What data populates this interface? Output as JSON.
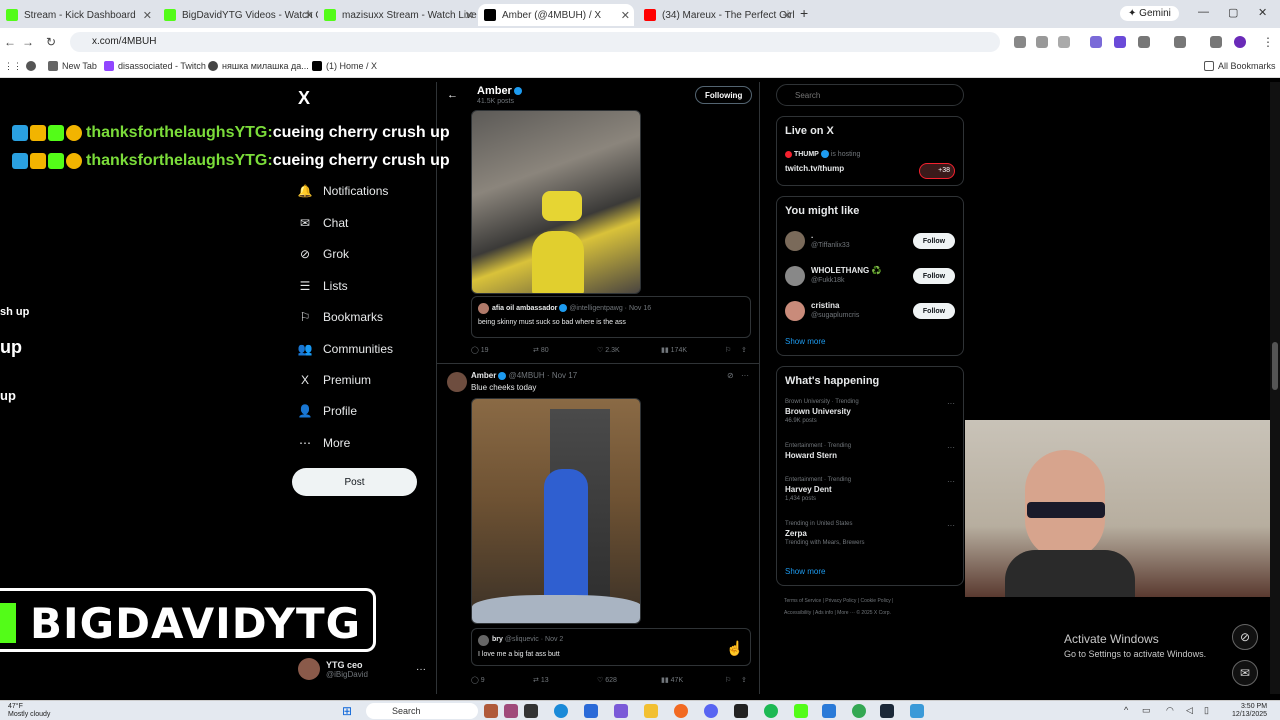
{
  "browser": {
    "tabs": [
      {
        "label": "Stream - Kick Dashboard",
        "color": "#53fc18"
      },
      {
        "label": "BigDavidYTG Videos - Watch O",
        "color": "#53fc18"
      },
      {
        "label": "mazisuxx Stream - Watch Live o",
        "color": "#53fc18"
      },
      {
        "label": "Amber (@4MBUH) / X",
        "color": "#000000"
      },
      {
        "label": "(34) Mareux - The Perfect Girl",
        "color": "#ff0000"
      }
    ],
    "gemini_label": "Gemini",
    "url": "x.com/4MBUH",
    "bookmarks": [
      "New Tab",
      "disassociated - Twitch",
      "няшка милашка да...",
      "(1) Home / X"
    ],
    "all_bookmarks": "All Bookmarks"
  },
  "x": {
    "logo": "X",
    "nav": [
      {
        "label": "Notifications",
        "icon": "bell-icon",
        "glyph": "🔔"
      },
      {
        "label": "Chat",
        "icon": "chat-icon",
        "glyph": "✉"
      },
      {
        "label": "Grok",
        "icon": "grok-icon",
        "glyph": "⊘"
      },
      {
        "label": "Lists",
        "icon": "lists-icon",
        "glyph": "☰"
      },
      {
        "label": "Bookmarks",
        "icon": "bookmark-icon",
        "glyph": "⚐"
      },
      {
        "label": "Communities",
        "icon": "communities-icon",
        "glyph": "👥"
      },
      {
        "label": "Premium",
        "icon": "premium-icon",
        "glyph": "X"
      },
      {
        "label": "Profile",
        "icon": "profile-icon",
        "glyph": "👤"
      },
      {
        "label": "More",
        "icon": "more-icon",
        "glyph": "⋯"
      }
    ],
    "post_button": "Post",
    "account": {
      "name": "YTG ceo",
      "handle": "@iBigDavid"
    },
    "header": {
      "name": "Amber",
      "count": "41.5K posts",
      "follow_state": "Following"
    },
    "quote1": {
      "name": "afia oil ambassador",
      "handle": "@intelligentpawg · Nov 16",
      "text": "being skinny must suck so bad where is the ass"
    },
    "actions1": {
      "replies": "19",
      "reposts": "80",
      "likes": "2.3K",
      "views": "174K"
    },
    "tweet2": {
      "name": "Amber",
      "handle": "@4MBUH · Nov 17",
      "text": "Blue cheeks today"
    },
    "quote2": {
      "name": "bry",
      "handle": "@sliquevic · Nov 2",
      "text": "I love me a big fat ass butt"
    },
    "actions2": {
      "replies": "9",
      "reposts": "13",
      "likes": "628",
      "views": "47K"
    }
  },
  "right": {
    "search_placeholder": "Search",
    "live": {
      "title": "Live on X",
      "host": "THUMP",
      "host_suffix": "is hosting",
      "link": "twitch.tv/thump",
      "badge": "+38"
    },
    "you_might_like": {
      "title": "You might like",
      "users": [
        {
          "name": ".",
          "handle": "@Tiffanlix33",
          "button": "Follow",
          "color": "#7a6a5a"
        },
        {
          "name": "WHOLETHANG ♻️",
          "handle": "@Fukk18k",
          "button": "Follow",
          "color": "#888888"
        },
        {
          "name": "cristina",
          "handle": "@sugaplumcris",
          "button": "Follow",
          "color": "#c98b7a"
        }
      ],
      "show_more": "Show more"
    },
    "happening": {
      "title": "What's happening",
      "trends": [
        {
          "category": "Brown University · Trending",
          "title": "Brown University",
          "count": "46.9K posts"
        },
        {
          "category": "Entertainment · Trending",
          "title": "Howard Stern",
          "count": ""
        },
        {
          "category": "Entertainment · Trending",
          "title": "Harvey Dent",
          "count": "1,434 posts"
        },
        {
          "category": "Trending in United States",
          "title": "Zerpa",
          "count": "Trending with Mears, Brewers"
        }
      ],
      "show_more": "Show more"
    },
    "footer1": "Terms of Service   |   Privacy Policy   |   Cookie Policy   |",
    "footer2": "Accessibility   |   Ads info   |   More ···   © 2025 X Corp."
  },
  "overlay": {
    "chat_user": "thanksforthelaughsYTG:",
    "chat_msg": " cueing cherry crush up",
    "frag1": "sh up",
    "frag2": "up",
    "frag3": "up",
    "banner": "BIGDAVIDYTG",
    "activate_title": "Activate Windows",
    "activate_sub": "Go to Settings to activate Windows."
  },
  "taskbar": {
    "temp": "47°F",
    "weather": "Mostly cloudy",
    "search": "Search",
    "time": "3:50 PM",
    "date": "12/13/2025"
  }
}
